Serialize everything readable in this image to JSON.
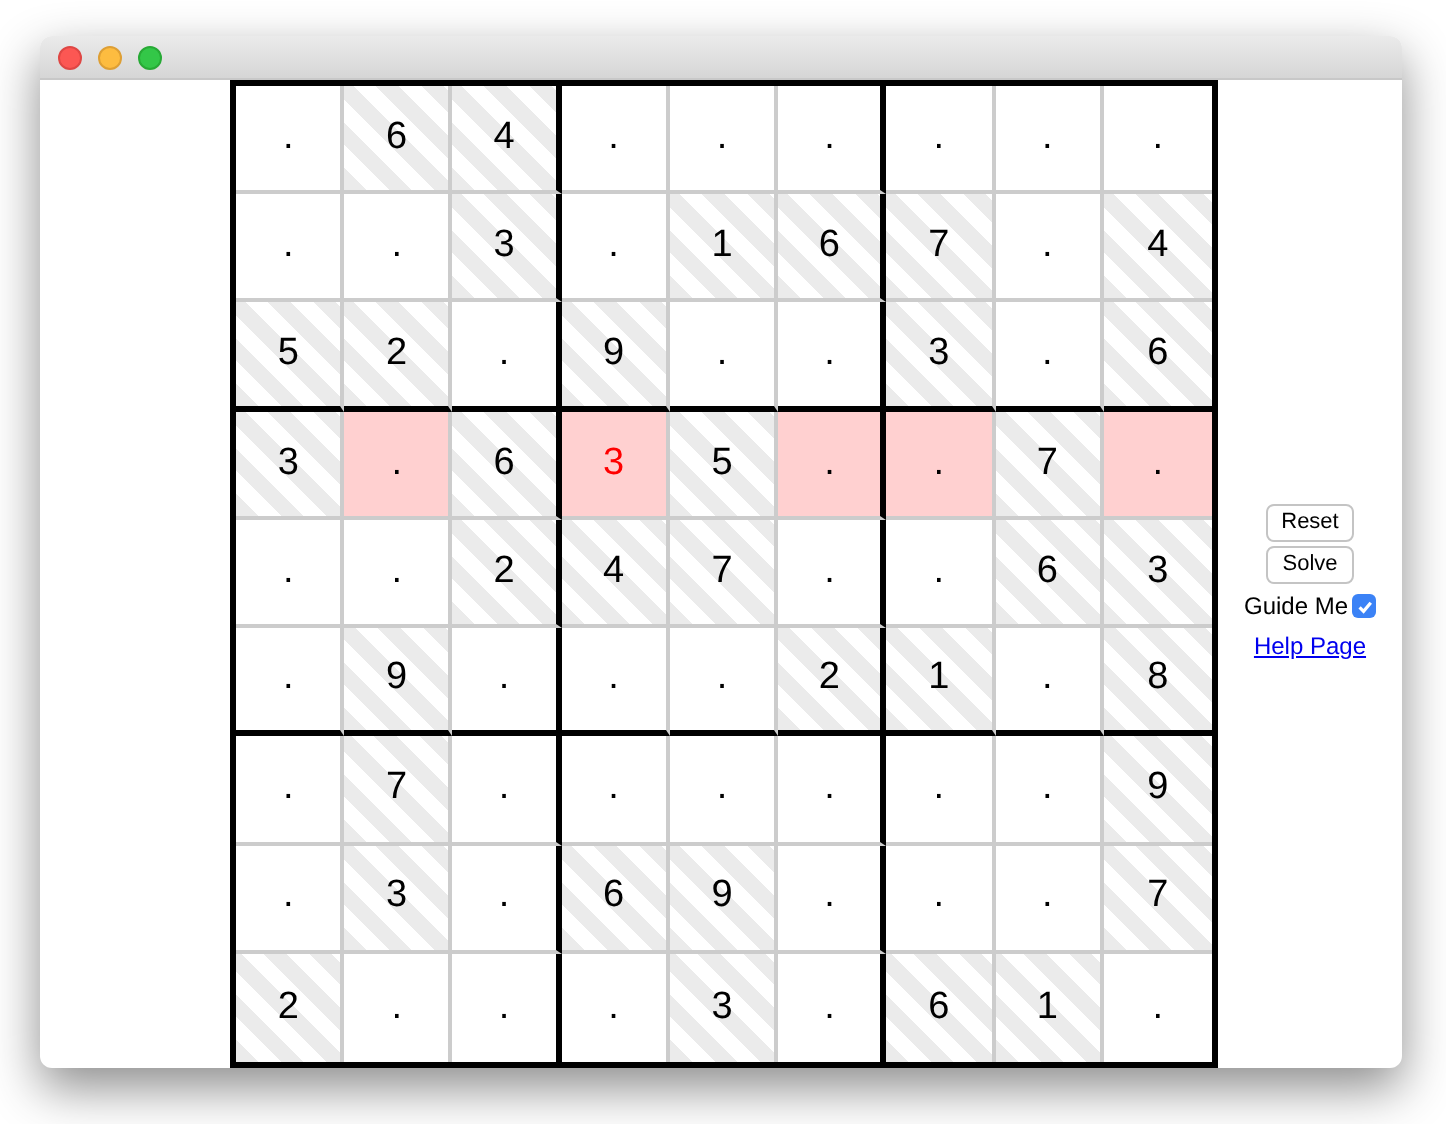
{
  "board": {
    "rows": [
      [
        {
          "value": ".",
          "given": false,
          "highlighted": false,
          "conflict": false
        },
        {
          "value": "6",
          "given": true,
          "highlighted": false,
          "conflict": false
        },
        {
          "value": "4",
          "given": true,
          "highlighted": false,
          "conflict": false
        },
        {
          "value": ".",
          "given": false,
          "highlighted": false,
          "conflict": false
        },
        {
          "value": ".",
          "given": false,
          "highlighted": false,
          "conflict": false
        },
        {
          "value": ".",
          "given": false,
          "highlighted": false,
          "conflict": false
        },
        {
          "value": ".",
          "given": false,
          "highlighted": false,
          "conflict": false
        },
        {
          "value": ".",
          "given": false,
          "highlighted": false,
          "conflict": false
        },
        {
          "value": ".",
          "given": false,
          "highlighted": false,
          "conflict": false
        }
      ],
      [
        {
          "value": ".",
          "given": false,
          "highlighted": false,
          "conflict": false
        },
        {
          "value": ".",
          "given": false,
          "highlighted": false,
          "conflict": false
        },
        {
          "value": "3",
          "given": true,
          "highlighted": false,
          "conflict": false
        },
        {
          "value": ".",
          "given": false,
          "highlighted": false,
          "conflict": false
        },
        {
          "value": "1",
          "given": true,
          "highlighted": false,
          "conflict": false
        },
        {
          "value": "6",
          "given": true,
          "highlighted": false,
          "conflict": false
        },
        {
          "value": "7",
          "given": true,
          "highlighted": false,
          "conflict": false
        },
        {
          "value": ".",
          "given": false,
          "highlighted": false,
          "conflict": false
        },
        {
          "value": "4",
          "given": true,
          "highlighted": false,
          "conflict": false
        }
      ],
      [
        {
          "value": "5",
          "given": true,
          "highlighted": false,
          "conflict": false
        },
        {
          "value": "2",
          "given": true,
          "highlighted": false,
          "conflict": false
        },
        {
          "value": ".",
          "given": false,
          "highlighted": false,
          "conflict": false
        },
        {
          "value": "9",
          "given": true,
          "highlighted": false,
          "conflict": false
        },
        {
          "value": ".",
          "given": false,
          "highlighted": false,
          "conflict": false
        },
        {
          "value": ".",
          "given": false,
          "highlighted": false,
          "conflict": false
        },
        {
          "value": "3",
          "given": true,
          "highlighted": false,
          "conflict": false
        },
        {
          "value": ".",
          "given": false,
          "highlighted": false,
          "conflict": false
        },
        {
          "value": "6",
          "given": true,
          "highlighted": false,
          "conflict": false
        }
      ],
      [
        {
          "value": "3",
          "given": true,
          "highlighted": false,
          "conflict": false
        },
        {
          "value": ".",
          "given": false,
          "highlighted": true,
          "conflict": false
        },
        {
          "value": "6",
          "given": true,
          "highlighted": false,
          "conflict": false
        },
        {
          "value": "3",
          "given": false,
          "highlighted": true,
          "conflict": true
        },
        {
          "value": "5",
          "given": true,
          "highlighted": false,
          "conflict": false
        },
        {
          "value": ".",
          "given": false,
          "highlighted": true,
          "conflict": false
        },
        {
          "value": ".",
          "given": false,
          "highlighted": true,
          "conflict": false
        },
        {
          "value": "7",
          "given": true,
          "highlighted": false,
          "conflict": false
        },
        {
          "value": ".",
          "given": false,
          "highlighted": true,
          "conflict": false
        }
      ],
      [
        {
          "value": ".",
          "given": false,
          "highlighted": false,
          "conflict": false
        },
        {
          "value": ".",
          "given": false,
          "highlighted": false,
          "conflict": false
        },
        {
          "value": "2",
          "given": true,
          "highlighted": false,
          "conflict": false
        },
        {
          "value": "4",
          "given": true,
          "highlighted": false,
          "conflict": false
        },
        {
          "value": "7",
          "given": true,
          "highlighted": false,
          "conflict": false
        },
        {
          "value": ".",
          "given": false,
          "highlighted": false,
          "conflict": false
        },
        {
          "value": ".",
          "given": false,
          "highlighted": false,
          "conflict": false
        },
        {
          "value": "6",
          "given": true,
          "highlighted": false,
          "conflict": false
        },
        {
          "value": "3",
          "given": true,
          "highlighted": false,
          "conflict": false
        }
      ],
      [
        {
          "value": ".",
          "given": false,
          "highlighted": false,
          "conflict": false
        },
        {
          "value": "9",
          "given": true,
          "highlighted": false,
          "conflict": false
        },
        {
          "value": ".",
          "given": false,
          "highlighted": false,
          "conflict": false
        },
        {
          "value": ".",
          "given": false,
          "highlighted": false,
          "conflict": false
        },
        {
          "value": ".",
          "given": false,
          "highlighted": false,
          "conflict": false
        },
        {
          "value": "2",
          "given": true,
          "highlighted": false,
          "conflict": false
        },
        {
          "value": "1",
          "given": true,
          "highlighted": false,
          "conflict": false
        },
        {
          "value": ".",
          "given": false,
          "highlighted": false,
          "conflict": false
        },
        {
          "value": "8",
          "given": true,
          "highlighted": false,
          "conflict": false
        }
      ],
      [
        {
          "value": ".",
          "given": false,
          "highlighted": false,
          "conflict": false
        },
        {
          "value": "7",
          "given": true,
          "highlighted": false,
          "conflict": false
        },
        {
          "value": ".",
          "given": false,
          "highlighted": false,
          "conflict": false
        },
        {
          "value": ".",
          "given": false,
          "highlighted": false,
          "conflict": false
        },
        {
          "value": ".",
          "given": false,
          "highlighted": false,
          "conflict": false
        },
        {
          "value": ".",
          "given": false,
          "highlighted": false,
          "conflict": false
        },
        {
          "value": ".",
          "given": false,
          "highlighted": false,
          "conflict": false
        },
        {
          "value": ".",
          "given": false,
          "highlighted": false,
          "conflict": false
        },
        {
          "value": "9",
          "given": true,
          "highlighted": false,
          "conflict": false
        }
      ],
      [
        {
          "value": ".",
          "given": false,
          "highlighted": false,
          "conflict": false
        },
        {
          "value": "3",
          "given": true,
          "highlighted": false,
          "conflict": false
        },
        {
          "value": ".",
          "given": false,
          "highlighted": false,
          "conflict": false
        },
        {
          "value": "6",
          "given": true,
          "highlighted": false,
          "conflict": false
        },
        {
          "value": "9",
          "given": true,
          "highlighted": false,
          "conflict": false
        },
        {
          "value": ".",
          "given": false,
          "highlighted": false,
          "conflict": false
        },
        {
          "value": ".",
          "given": false,
          "highlighted": false,
          "conflict": false
        },
        {
          "value": ".",
          "given": false,
          "highlighted": false,
          "conflict": false
        },
        {
          "value": "7",
          "given": true,
          "highlighted": false,
          "conflict": false
        }
      ],
      [
        {
          "value": "2",
          "given": true,
          "highlighted": false,
          "conflict": false
        },
        {
          "value": ".",
          "given": false,
          "highlighted": false,
          "conflict": false
        },
        {
          "value": ".",
          "given": false,
          "highlighted": false,
          "conflict": false
        },
        {
          "value": ".",
          "given": false,
          "highlighted": false,
          "conflict": false
        },
        {
          "value": "3",
          "given": true,
          "highlighted": false,
          "conflict": false
        },
        {
          "value": ".",
          "given": false,
          "highlighted": false,
          "conflict": false
        },
        {
          "value": "6",
          "given": true,
          "highlighted": false,
          "conflict": false
        },
        {
          "value": "1",
          "given": true,
          "highlighted": false,
          "conflict": false
        },
        {
          "value": ".",
          "given": false,
          "highlighted": false,
          "conflict": false
        }
      ]
    ]
  },
  "buttons": [
    "Reset",
    "Solve"
  ],
  "guide_me": {
    "label": "Guide Me",
    "checked": true
  },
  "help_link": "Help Page"
}
